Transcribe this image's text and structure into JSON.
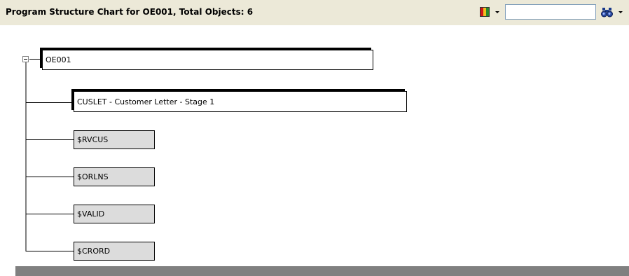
{
  "header": {
    "title": "Program Structure Chart for OE001, Total Objects: 6",
    "find_value": ""
  },
  "icons": {
    "color_legend": "color-legend-icon",
    "find": "binoculars-icon",
    "dropdown": "chevron-down-icon",
    "collapse": "minus-box-icon"
  },
  "colors": {
    "toolbar_bg": "#ece9d8",
    "node_copy_bg": "#dcdcdc",
    "node_program_bg": "#ffffff",
    "bottom_bar": "#808080"
  },
  "tree": {
    "root": {
      "label": "OE001",
      "type": "program",
      "expanded": true
    },
    "children": [
      {
        "label": "CUSLET - Customer Letter - Stage 1",
        "type": "program"
      },
      {
        "label": "$RVCUS",
        "type": "copybook"
      },
      {
        "label": "$ORLNS",
        "type": "copybook"
      },
      {
        "label": "$VALID",
        "type": "copybook"
      },
      {
        "label": "$CRORD",
        "type": "copybook"
      }
    ]
  }
}
